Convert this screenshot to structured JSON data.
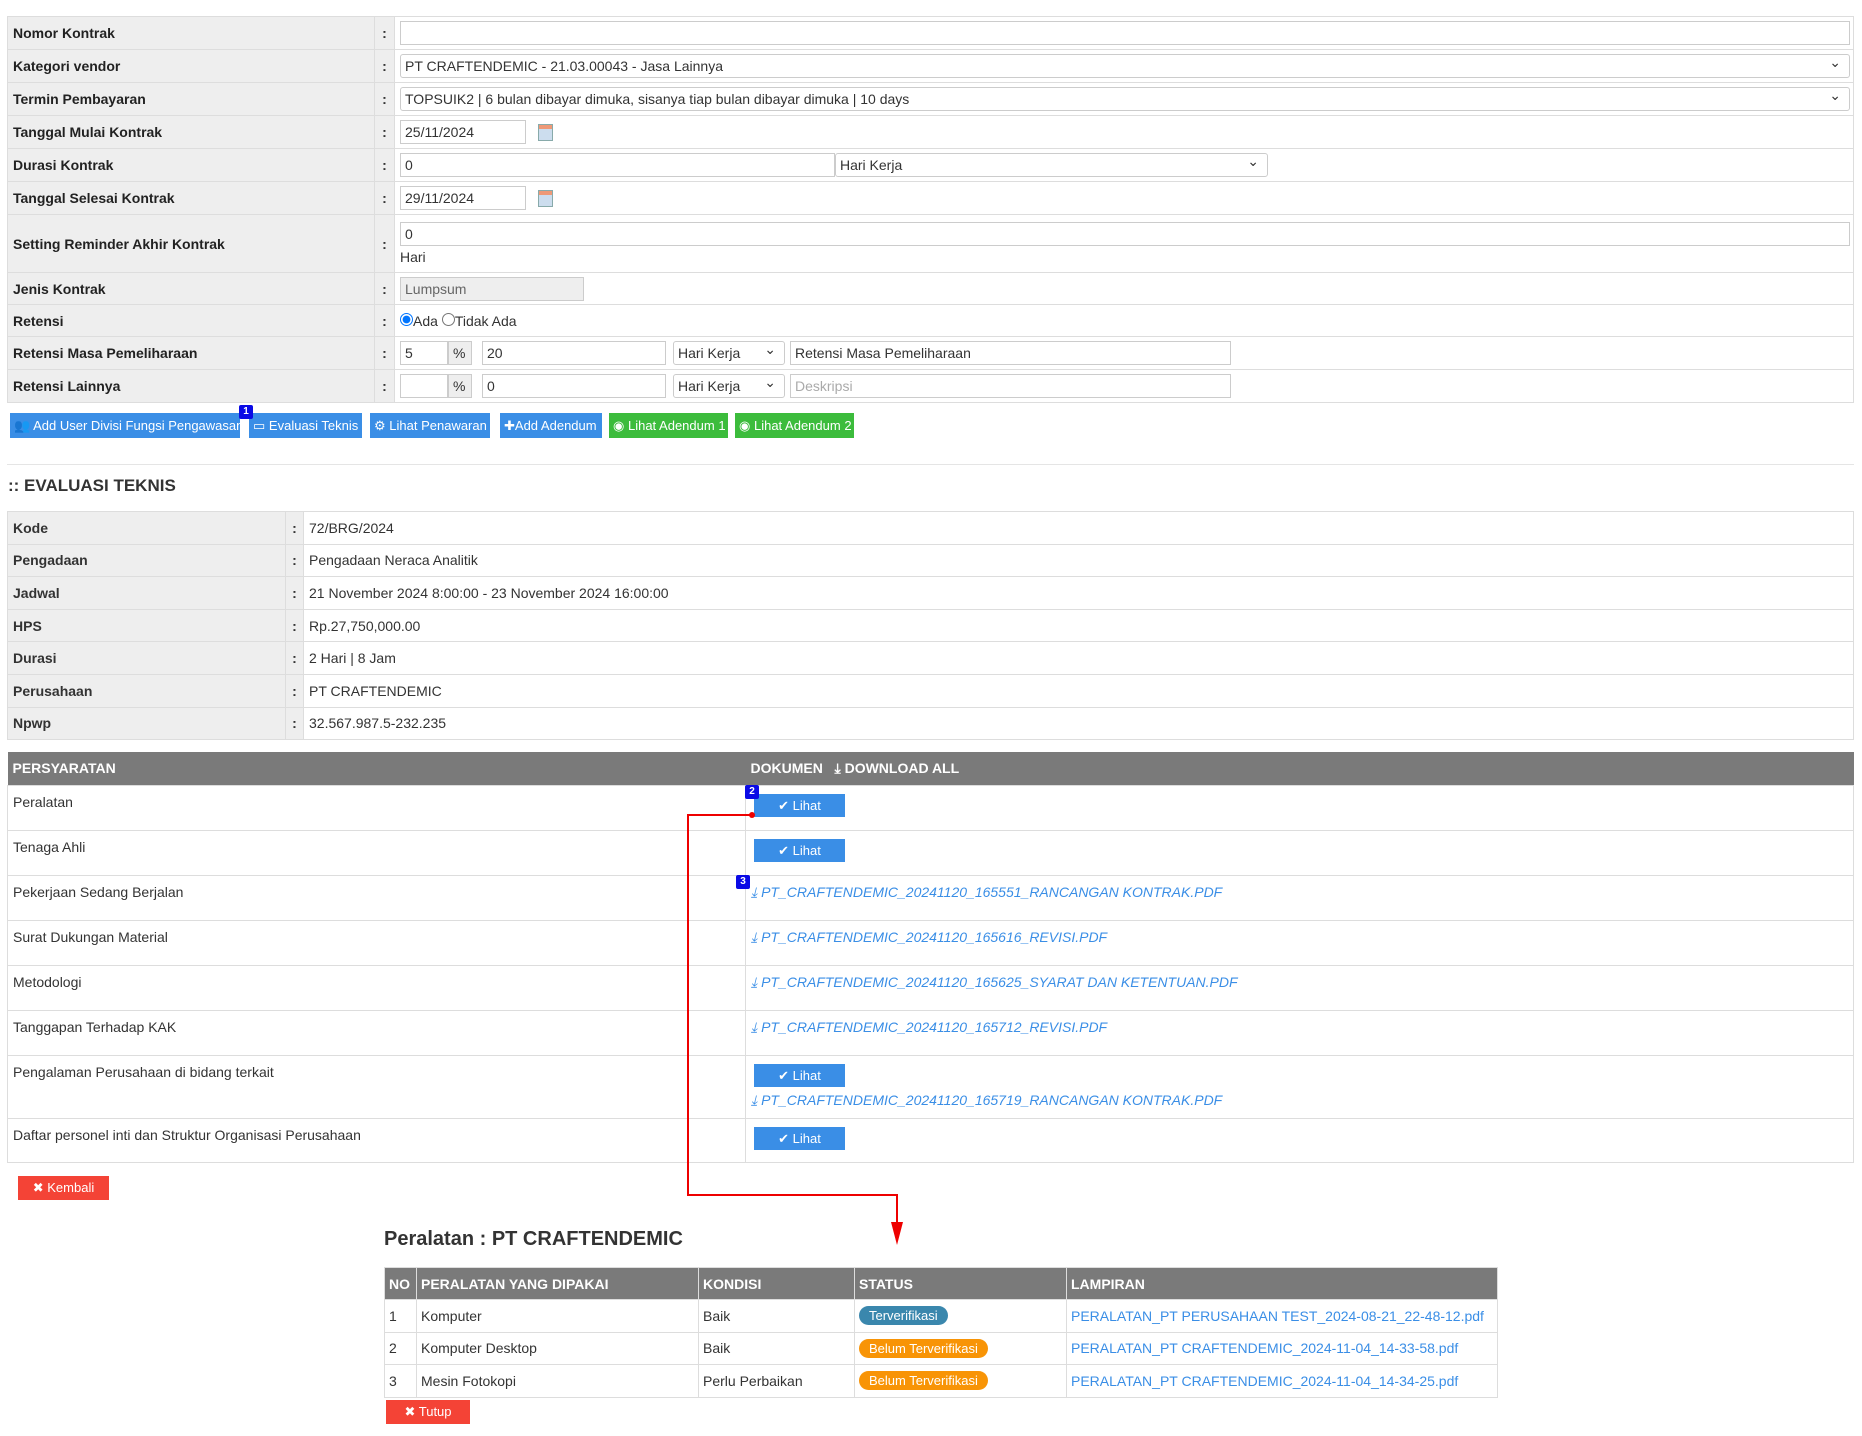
{
  "form": {
    "nomor_kontrak": {
      "label": "Nomor Kontrak",
      "value": ""
    },
    "kategori_vendor": {
      "label": "Kategori vendor",
      "value": "PT CRAFTENDEMIC - 21.03.00043 - Jasa Lainnya"
    },
    "termin": {
      "label": "Termin Pembayaran",
      "value": "TOPSUIK2 | 6 bulan dibayar dimuka, sisanya tiap bulan dibayar dimuka | 10 days"
    },
    "tgl_mulai": {
      "label": "Tanggal Mulai Kontrak",
      "value": "25/11/2024"
    },
    "durasi": {
      "label": "Durasi Kontrak",
      "value": "0",
      "unit": "Hari Kerja"
    },
    "tgl_selesai": {
      "label": "Tanggal Selesai Kontrak",
      "value": "29/11/2024"
    },
    "reminder": {
      "label": "Setting Reminder Akhir Kontrak",
      "value": "0",
      "unit": "Hari"
    },
    "jenis": {
      "label": "Jenis Kontrak",
      "value": "Lumpsum"
    },
    "retensi": {
      "label": "Retensi",
      "opt1": "Ada",
      "opt2": "Tidak Ada",
      "selected": "Ada"
    },
    "retensi_masa": {
      "label": "Retensi Masa Pemeliharaan",
      "pct": "5",
      "pct_sign": "%",
      "days": "20",
      "unit": "Hari Kerja",
      "desc": "Retensi Masa Pemeliharaan"
    },
    "retensi_lain": {
      "label": "Retensi Lainnya",
      "pct": "",
      "pct_sign": "%",
      "days": "0",
      "unit": "Hari Kerja",
      "desc_placeholder": "Deskripsi"
    },
    "colon": ":"
  },
  "buttons": {
    "add_user": "Add User Divisi Fungsi Pengawasan",
    "evaluasi": "Evaluasi Teknis",
    "penawaran": "Lihat Penawaran",
    "add_adendum": "Add Adendum",
    "adendum1": "Lihat Adendum 1",
    "adendum2": "Lihat Adendum 2"
  },
  "markers": [
    "1",
    "2",
    "3"
  ],
  "section_title": ":: EVALUASI TEKNIS",
  "info": [
    {
      "label": "Kode",
      "value": "72/BRG/2024"
    },
    {
      "label": "Pengadaan",
      "value": "Pengadaan Neraca Analitik"
    },
    {
      "label": "Jadwal",
      "value": "21 November 2024 8:00:00 - 23 November 2024 16:00:00"
    },
    {
      "label": "HPS",
      "value": "Rp.27,750,000.00"
    },
    {
      "label": "Durasi",
      "value": "2 Hari | 8 Jam"
    },
    {
      "label": "Perusahaan",
      "value": "PT CRAFTENDEMIC"
    },
    {
      "label": "Npwp",
      "value": "32.567.987.5-232.235"
    }
  ],
  "requirements": {
    "col1": "PERSYARATAN",
    "col2": "DOKUMEN",
    "download_all": "DOWNLOAD ALL",
    "lihat": "Lihat",
    "rows": [
      {
        "name": "Peralatan",
        "file": ""
      },
      {
        "name": "Tenaga Ahli",
        "file": ""
      },
      {
        "name": "Pekerjaan Sedang Berjalan",
        "file": "PT_CRAFTENDEMIC_20241120_165551_RANCANGAN KONTRAK.PDF"
      },
      {
        "name": "Surat Dukungan Material",
        "file": "PT_CRAFTENDEMIC_20241120_165616_REVISI.PDF"
      },
      {
        "name": "Metodologi",
        "file": "PT_CRAFTENDEMIC_20241120_165625_SYARAT DAN KETENTUAN.PDF"
      },
      {
        "name": "Tanggapan Terhadap KAK",
        "file": "PT_CRAFTENDEMIC_20241120_165712_REVISI.PDF"
      },
      {
        "name": "Pengalaman Perusahaan di bidang terkait",
        "file": "PT_CRAFTENDEMIC_20241120_165719_RANCANGAN KONTRAK.PDF"
      },
      {
        "name": "Daftar personel inti dan Struktur Organisasi Perusahaan",
        "file": ""
      }
    ]
  },
  "kembali": "Kembali",
  "modal": {
    "title": "Peralatan : PT CRAFTENDEMIC",
    "headers": [
      "NO",
      "PERALATAN YANG DIPAKAI",
      "KONDISI",
      "STATUS",
      "LAMPIRAN"
    ],
    "rows": [
      {
        "no": "1",
        "name": "Komputer",
        "kondisi": "Baik",
        "status": "Terverifikasi",
        "file": "PERALATAN_PT PERUSAHAAN TEST_2024-08-21_22-48-12.pdf"
      },
      {
        "no": "2",
        "name": "Komputer Desktop",
        "kondisi": "Baik",
        "status": "Belum Terverifikasi",
        "file": "PERALATAN_PT CRAFTENDEMIC_2024-11-04_14-33-58.pdf"
      },
      {
        "no": "3",
        "name": "Mesin Fotokopi",
        "kondisi": "Perlu Perbaikan",
        "status": "Belum Terverifikasi",
        "file": "PERALATAN_PT CRAFTENDEMIC_2024-11-04_14-34-25.pdf"
      }
    ],
    "close": "Tutup"
  },
  "colors": {
    "blue": "#3a8ee6",
    "green": "#3cbc3c",
    "red": "#f44336",
    "verified": "#3a87ad",
    "unverified": "#f89406"
  }
}
